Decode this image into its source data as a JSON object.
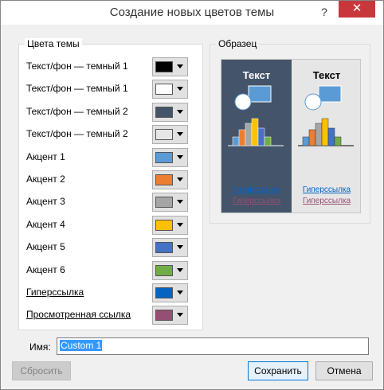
{
  "window": {
    "title": "Создание новых цветов темы",
    "help_glyph": "?",
    "close_glyph": "✕"
  },
  "theme_colors": {
    "legend": "Цвета темы",
    "rows": [
      {
        "label": "Текст/фон — темный 1",
        "color": "#000000"
      },
      {
        "label": "Текст/фон — темный 1",
        "color": "#ffffff"
      },
      {
        "label": "Текст/фон — темный 2",
        "color": "#44546a"
      },
      {
        "label": "Текст/фон — темный 2",
        "color": "#e7e6e6"
      },
      {
        "label": "Акцент 1",
        "color": "#5b9bd5"
      },
      {
        "label": "Акцент 2",
        "color": "#ed7d31"
      },
      {
        "label": "Акцент 3",
        "color": "#a5a5a5"
      },
      {
        "label": "Акцент 4",
        "color": "#ffc000"
      },
      {
        "label": "Акцент 5",
        "color": "#4472c4"
      },
      {
        "label": "Акцент 6",
        "color": "#70ad47"
      },
      {
        "label": "Гиперссылка",
        "color": "#0563c1"
      },
      {
        "label": "Просмотренная ссылка",
        "color": "#954f72"
      }
    ]
  },
  "sample": {
    "legend": "Образец",
    "dark_title": "Текст",
    "light_title": "Текст",
    "hyperlink": "Гиперссылка",
    "visited_link": "Гиперссылка"
  },
  "name": {
    "label": "Имя:",
    "value": "Custom 1"
  },
  "buttons": {
    "reset": "Сбросить",
    "save": "Сохранить",
    "cancel": "Отмена"
  }
}
